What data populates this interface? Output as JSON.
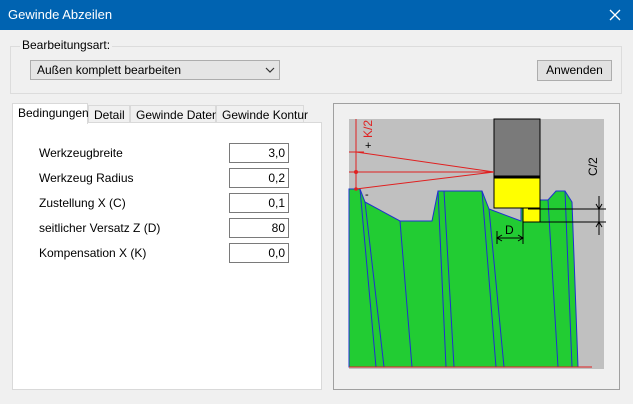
{
  "window": {
    "title": "Gewinde Abzeilen"
  },
  "top": {
    "group_label": "Bearbeitungsart:",
    "mode_value": "Außen komplett bearbeiten",
    "apply_label": "Anwenden"
  },
  "tabs": [
    {
      "label": "Bedingungen"
    },
    {
      "label": "Detail"
    },
    {
      "label": "Gewinde Daten"
    },
    {
      "label": "Gewinde Kontur"
    }
  ],
  "fields": [
    {
      "label": "Werkzeugbreite",
      "value": "3,0"
    },
    {
      "label": "Werkzeug Radius",
      "value": "0,2"
    },
    {
      "label": "Zustellung X (C)",
      "value": "0,1"
    },
    {
      "label": "seitlicher Versatz Z (D)",
      "value": "80"
    },
    {
      "label": "Kompensation X (K)",
      "value": "0,0"
    }
  ],
  "diagram": {
    "label_k": "K/2",
    "label_c": "C/2",
    "label_d": "D",
    "plus": "+",
    "minus": "-",
    "colors": {
      "thread": "#22cc33",
      "tool_body": "#7a7a7a",
      "tool_tip": "#ffff00",
      "dim": "#e02020"
    }
  }
}
